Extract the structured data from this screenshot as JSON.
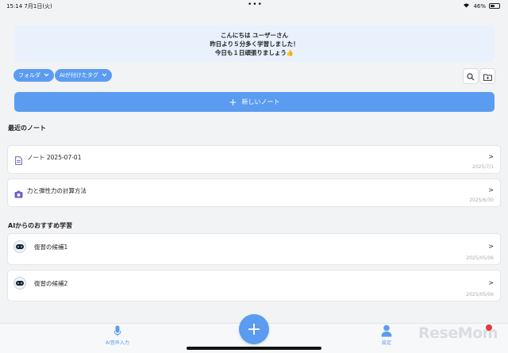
{
  "status_bar": {
    "time": "15:14",
    "date": "7月1日(火)",
    "battery": "46%"
  },
  "banner": {
    "line1": "こんにちは ユーザーさん",
    "line2": "昨日より５分多く学習しました！",
    "line3": "今日も１日頑張りましょう👍"
  },
  "filters": {
    "folder_label": "フォルダ",
    "ai_tag_label": "AIが付けたタグ"
  },
  "new_note_label": "新しいノート",
  "recent": {
    "title": "最近のノート",
    "items": [
      {
        "label": "ノート 2025-07-01",
        "date": "2025/7/1",
        "arrow": ">"
      },
      {
        "label": "力と弾性力の計算方法",
        "date": "2025/6/30",
        "arrow": ">"
      }
    ]
  },
  "recommend": {
    "title": "AIからのおすすめ学習",
    "items": [
      {
        "label": "復習の候補1",
        "date": "2025/05/06",
        "arrow": ">"
      },
      {
        "label": "復習の候補2",
        "date": "2025/05/06",
        "arrow": ">"
      }
    ]
  },
  "tabbar": {
    "voice_label": "AI音声入力",
    "settings_label": "設定",
    "fab_symbol": "+"
  },
  "watermark": "ReseMom",
  "colors": {
    "accent": "#5b9cf0",
    "banner_bg": "#e8f1fc",
    "page_bg": "#f2f3f5"
  }
}
